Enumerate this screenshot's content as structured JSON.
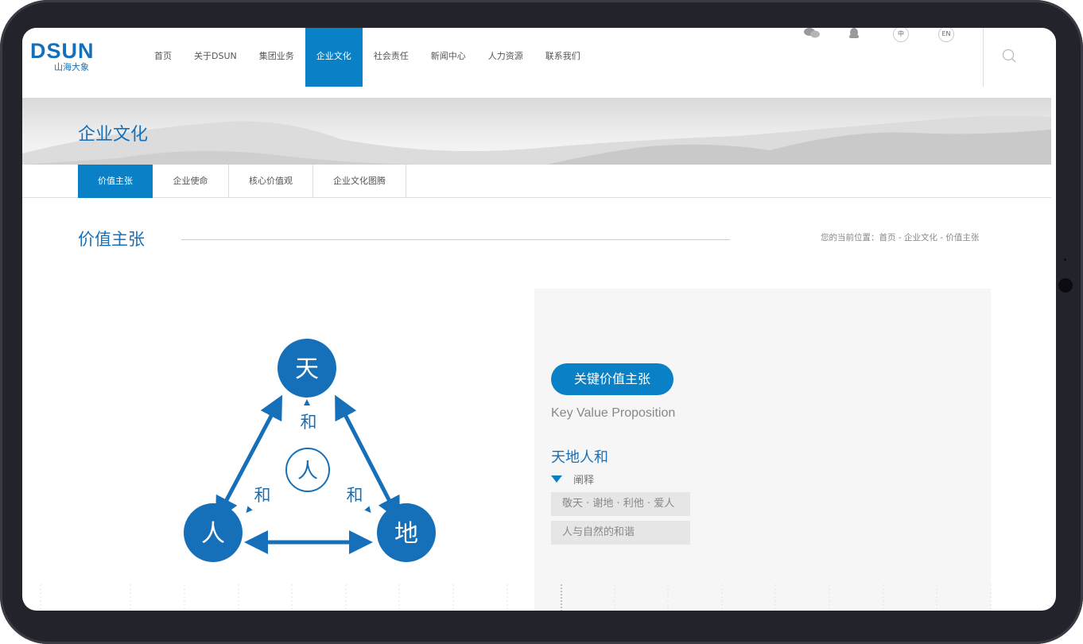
{
  "brand": {
    "logo_text": "DSUN",
    "logo_sub": "山海大象",
    "color": "#1670b9",
    "accent": "#0a80c6"
  },
  "nav": {
    "items": [
      {
        "label": "首页"
      },
      {
        "label": "关于DSUN"
      },
      {
        "label": "集团业务"
      },
      {
        "label": "企业文化",
        "active": true
      },
      {
        "label": "社会责任"
      },
      {
        "label": "新闻中心"
      },
      {
        "label": "人力资源"
      },
      {
        "label": "联系我们"
      }
    ]
  },
  "top_bar": {
    "wechat_icon": "wechat-icon",
    "qq_icon": "qq-icon",
    "lang_zh": "中",
    "lang_en": "EN",
    "search_icon": "search-icon"
  },
  "banner": {
    "title": "企业文化"
  },
  "subtabs": [
    {
      "label": "价值主张",
      "active": true
    },
    {
      "label": "企业使命"
    },
    {
      "label": "核心价值观"
    },
    {
      "label": "企业文化图腾"
    }
  ],
  "section": {
    "title": "价值主张",
    "breadcrumb": "您的当前位置：首页 - 企业文化 - 价值主张"
  },
  "diagram": {
    "top": "天",
    "left": "人",
    "right": "地",
    "center": "人",
    "edge_labels": [
      "和",
      "和",
      "和"
    ]
  },
  "panel": {
    "pill": "关键价值主张",
    "subtitle": "Key Value Proposition",
    "heading": "天地人和",
    "explain_label": "阐释",
    "tags": [
      "敬天 · 谢地 · 利他 · 爱人",
      "人与自然的和谐"
    ]
  }
}
